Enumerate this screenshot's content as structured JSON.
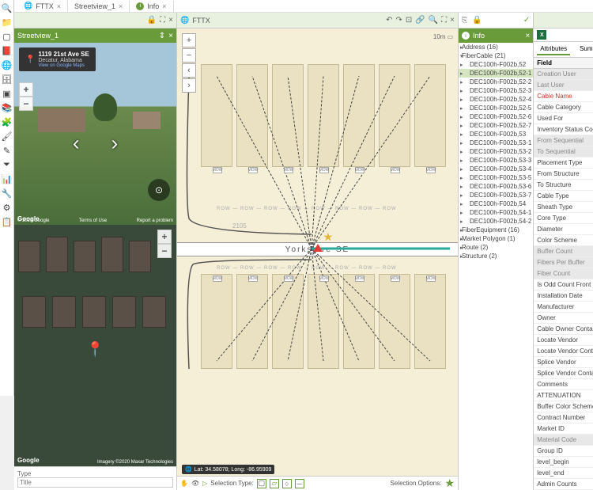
{
  "tabs": {
    "fttx": "FTTX",
    "sv": "Streetview_1",
    "info": "Info"
  },
  "toolbar_icons": [
    "magnify",
    "folder",
    "square",
    "book",
    "globe",
    "database",
    "cube",
    "layers",
    "puzzle",
    "brush",
    "pencil",
    "funnel",
    "chart",
    "wrench",
    "gear",
    "clipboard"
  ],
  "streetview": {
    "title": "Streetview_1",
    "address_line1": "1119 21st Ave SE",
    "address_line2": "Decatur, Alabama",
    "view_link": "View on Google Maps",
    "google": "Google",
    "footer_left": "© 2020 Google",
    "footer_mid": "Terms of Use",
    "footer_right": "Report a problem"
  },
  "satellite": {
    "footer": "Imagery ©2020 Maxar Technologies"
  },
  "type_label": "Type",
  "title_placeholder": "Title",
  "fttx_header": "FTTX",
  "map": {
    "street": "Yorkshire  SE",
    "house_num": "2105",
    "coords": "Lat: 34.58078; Long: -86.95909",
    "scale": "10m",
    "sel_type": "Selection Type:",
    "sel_opts": "Selection Options:"
  },
  "info": {
    "title": "Info",
    "groups": {
      "address": "Address (16)",
      "fiber": "FiberCable (21)",
      "equip": "FiberEquipment (16)",
      "market": "Market Polygon (1)",
      "route": "Route (2)",
      "structure": "Structure (2)"
    },
    "fiber_items": [
      "DEC100h-F002b,52",
      "DEC100h-F002b,52-1",
      "DEC100h-F002b,52-2",
      "DEC100h-F002b,52-3",
      "DEC100h-F002b,52-4",
      "DEC100h-F002b,52-5",
      "DEC100h-F002b,52-6",
      "DEC100h-F002b,52-7",
      "DEC100h-F002b,53",
      "DEC100h-F002b,53-1",
      "DEC100h-F002b,53-2",
      "DEC100h-F002b,53-3",
      "DEC100h-F002b,53-4",
      "DEC100h-F002b,53-5",
      "DEC100h-F002b,53-6",
      "DEC100h-F002b,53-7",
      "DEC100h-F002b,54",
      "DEC100h-F002b,54-1",
      "DEC100h-F002b,54-2"
    ],
    "selected_index": 1
  },
  "attributes": {
    "tab_attr": "Attributes",
    "tab_sum": "Sum",
    "field_header": "Field",
    "fields": [
      {
        "n": "Creation User",
        "d": true
      },
      {
        "n": "Last User",
        "d": true
      },
      {
        "n": "Cable Name",
        "r": true
      },
      {
        "n": "Cable Category"
      },
      {
        "n": "Used For"
      },
      {
        "n": "Inventory Status Code"
      },
      {
        "n": "From Sequential",
        "d": true
      },
      {
        "n": "To Sequential",
        "d": true
      },
      {
        "n": "Placement Type"
      },
      {
        "n": "From Structure"
      },
      {
        "n": "To Structure"
      },
      {
        "n": "Cable Type"
      },
      {
        "n": "Sheath Type"
      },
      {
        "n": "Core Type"
      },
      {
        "n": "Diameter"
      },
      {
        "n": "Color Scheme"
      },
      {
        "n": "Buffer Count",
        "d": true
      },
      {
        "n": "Fibers Per Buffer",
        "d": true
      },
      {
        "n": "Fiber Count",
        "d": true
      },
      {
        "n": "Is Odd Count Front"
      },
      {
        "n": "Installation Date"
      },
      {
        "n": "Manufacturer"
      },
      {
        "n": "Owner"
      },
      {
        "n": "Cable Owner Contact Number"
      },
      {
        "n": "Locate Vendor"
      },
      {
        "n": "Locate Vendor Contact Number"
      },
      {
        "n": "Splice Vendor"
      },
      {
        "n": "Splice Vendor Contact Number"
      },
      {
        "n": "Comments"
      },
      {
        "n": "ATTENUATION"
      },
      {
        "n": "Buffer Color Scheme"
      },
      {
        "n": "Contract Number"
      },
      {
        "n": "Market ID"
      },
      {
        "n": "Material Code",
        "d": true
      },
      {
        "n": "Group ID"
      },
      {
        "n": "level_begin"
      },
      {
        "n": "level_end"
      },
      {
        "n": "Admin Counts"
      }
    ]
  },
  "icons": {
    "close": "×",
    "lock": "🔒",
    "expand": "⛶",
    "minimize": "⇕",
    "undo": "↶",
    "redo": "↷",
    "pin": "⎘",
    "search": "🔍",
    "crop": "⊡",
    "tools": "⚙",
    "check": "✓"
  }
}
